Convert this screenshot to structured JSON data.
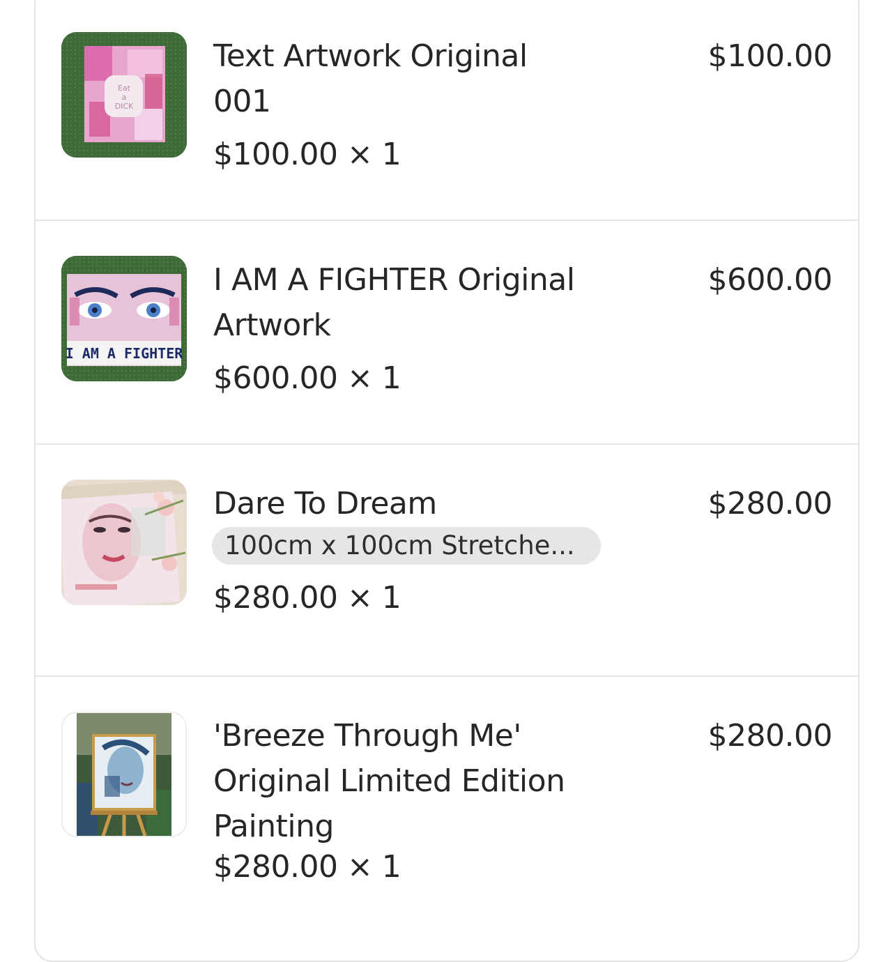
{
  "line_items": [
    {
      "title_line1": "Text Artwork Original",
      "title_line2": "001",
      "price": "$100.00",
      "unit_qty": "$100.00 × 1",
      "thumb_text": "Eat a DICK"
    },
    {
      "title_line1": "I AM A FIGHTER Original",
      "title_line2": "Artwork",
      "price": "$600.00",
      "unit_qty": "$600.00 × 1",
      "thumb_text": "I AM A FIGHTER"
    },
    {
      "title_line1": "Dare To Dream",
      "variant": "100cm x 100cm Stretche...",
      "price": "$280.00",
      "unit_qty": "$280.00 × 1"
    },
    {
      "title_line1": "'Breeze Through Me'",
      "title_line2": "Original Limited Edition",
      "title_line3": "Painting",
      "price": "$280.00",
      "unit_qty": "$280.00 × 1"
    }
  ],
  "colors": {
    "text": "#262626",
    "divider": "#e6e6e6",
    "variant_bg": "#e6e6e6"
  }
}
